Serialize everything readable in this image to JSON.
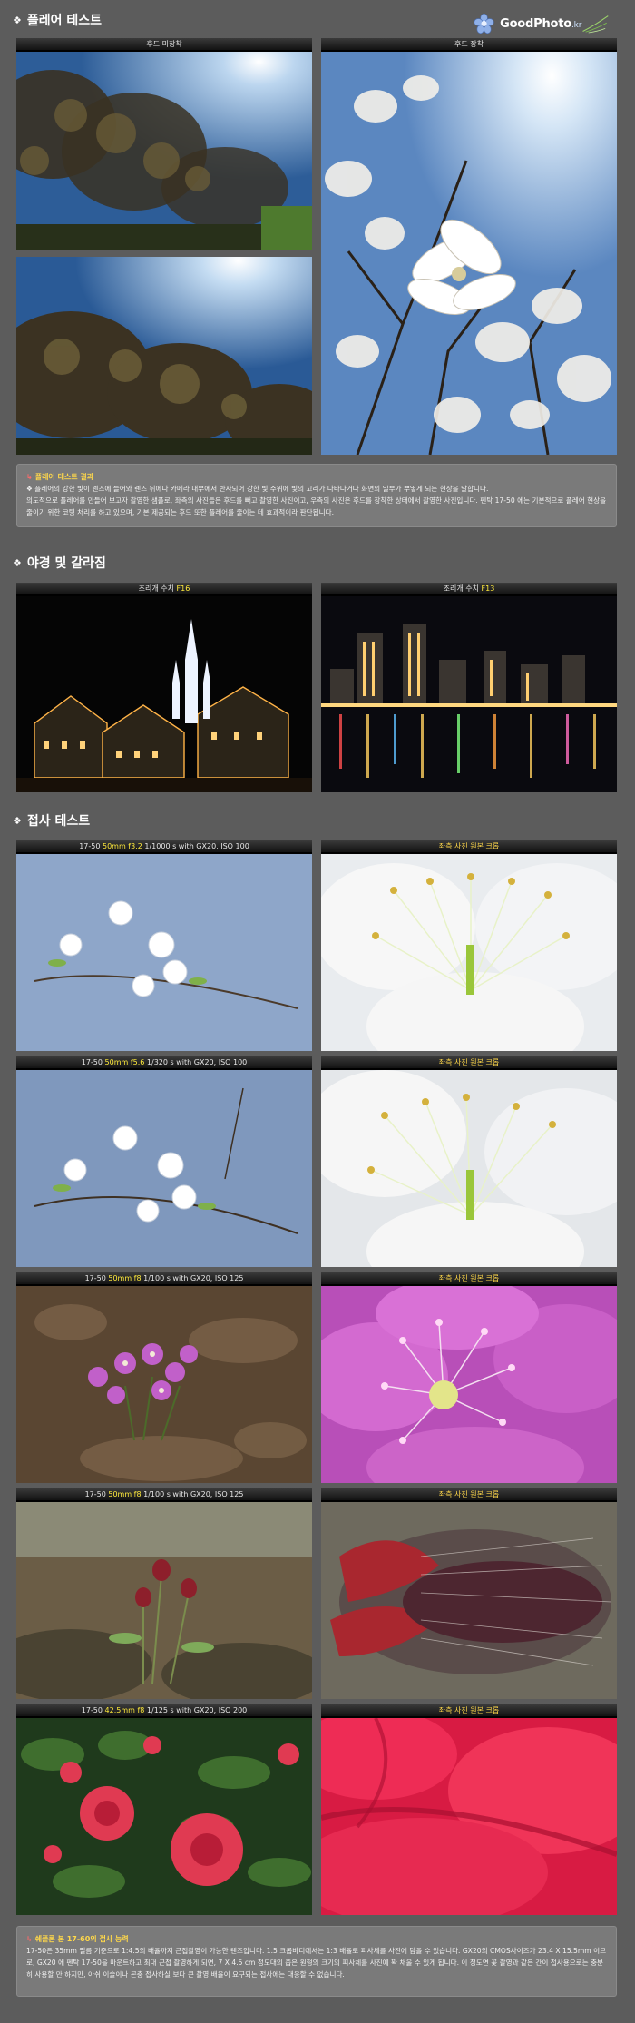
{
  "logo": {
    "text": "GoodPhoto",
    "suffix": ".kr"
  },
  "sections": {
    "flare": {
      "title": "플레어 테스트",
      "left_caption": "후드 미장착",
      "right_caption": "후드 장착",
      "box_title": "플레어 테스트 결과",
      "box_line1": "❖ 플레어의 강한 빛이 렌즈에 들어와 렌즈 뒤에나 카메라 내부에서 반사되어 강한 빛 주위에 빛의 고리가 나타나거나 화면의 일부가 뿌옇게 되는 현상을 말합니다.",
      "box_line2": "의도적으로 플레어를 만들어 보고자 촬영한 샘플로, 좌측의 사진들은 후드를 빼고 촬영한 사진이고, 우측의 사진은 후드를 장착한 상태에서 촬영한 사진입니다. 펜탁 17-50 에는 기본적으로 플레어 현상을 줄이기 위한 코팅 처리를 하고 있으며, 기본 제공되는 후드 또한 플레어를 줄이는 데 효과적이라 판단됩니다."
    },
    "night": {
      "title": "야경 및 갈라짐",
      "left_caption_prefix": "조리개 수치 ",
      "left_caption_value": "F16",
      "right_caption_prefix": "조리개 수치 ",
      "right_caption_value": "F13"
    },
    "macro": {
      "title": "접사 테스트",
      "rows": [
        {
          "cap_pre": "17-50 ",
          "cap_hl": "50mm f3.2",
          "cap_post": "  1/1000 s  with GX20, ISO 100",
          "crop": "좌측 사진 원본 크롭"
        },
        {
          "cap_pre": "17-50 ",
          "cap_hl": "50mm f5.6",
          "cap_post": "  1/320 s  with GX20, ISO 100",
          "crop": "좌측 사진 원본 크롭"
        },
        {
          "cap_pre": "17-50 ",
          "cap_hl": "50mm f8",
          "cap_post": "  1/100 s  with GX20, ISO 125",
          "crop": "좌측 사진 원본 크롭"
        },
        {
          "cap_pre": "17-50 ",
          "cap_hl": "50mm f8",
          "cap_post": "  1/100 s  with GX20, ISO 125",
          "crop": "좌측 사진 원본 크롭"
        },
        {
          "cap_pre": "17-50 ",
          "cap_hl": "42.5mm f8",
          "cap_post": "  1/125 s  with GX20, ISO 200",
          "crop": "좌측 사진 원본 크롭"
        }
      ],
      "box_title": "쉐플론 본 17-60의 접사 능력",
      "box_text": "17-50은 35mm 필름 기준으로 1:4.5의 배율까지 근접촬영이 가능한 렌즈입니다. 1.5 크롭바디에서는 1:3 배율로 피사체를 사진에 담을 수 있습니다. GX20의 CMOS사이즈가 23.4 X 15.5mm 이므로, GX20 에 펜탁 17-50을 마운트하고 최대 근접 촬영하게 되면, 7 X 4.5 cm 정도대의 좁은 원형의 크기의 피사체를 사진에 꽉 채울 수 있게 됩니다. 이 정도면 꽃 촬영과 같은 간이 접사용으로는 충분히 사용할 만 하지만, 아쉬 이슬이나 곤충 접사하실 보다 큰 촬영 배율이 요구되는 접사에는 대응할 수 없습니다."
    }
  }
}
